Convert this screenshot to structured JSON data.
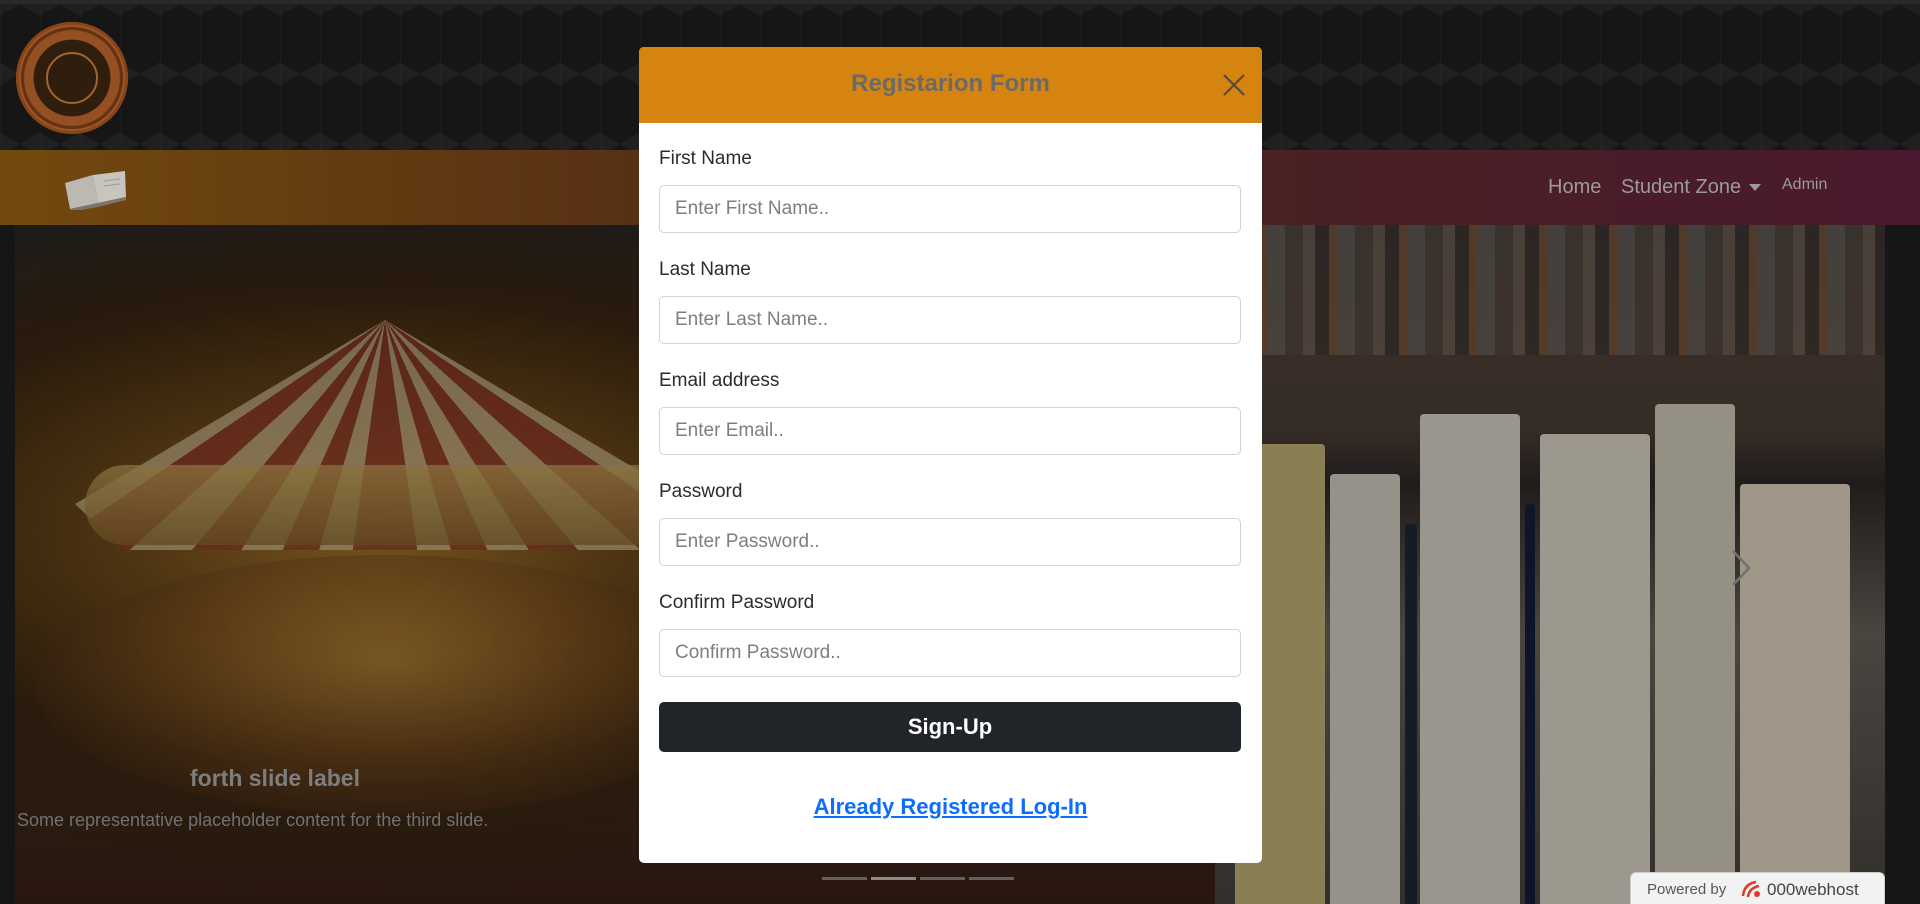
{
  "header": {
    "logo_alt": "A.S. Inter College seal logo"
  },
  "nav": {
    "items": [
      {
        "label": "Home"
      },
      {
        "label": "Student Zone"
      },
      {
        "label": "Admin"
      }
    ]
  },
  "carousel": {
    "caption_title": "forth slide label",
    "caption_text": "Some representative placeholder content for the third slide.",
    "indicator_count": 4,
    "active_indicator": 1
  },
  "modal": {
    "title": "Registarion Form",
    "fields": [
      {
        "label": "First Name",
        "placeholder": "Enter First Name.."
      },
      {
        "label": "Last Name",
        "placeholder": "Enter Last Name.."
      },
      {
        "label": "Email address",
        "placeholder": "Enter Email.."
      },
      {
        "label": "Password",
        "placeholder": "Enter Password.."
      },
      {
        "label": "Confirm Password",
        "placeholder": "Confirm Password.."
      }
    ],
    "submit_label": "Sign-Up",
    "login_link": "Already Registered Log-In"
  },
  "footer": {
    "powered_by": "Powered by",
    "host_name": "000webhost"
  },
  "colors": {
    "modal_header": "#d5840f",
    "button_dark": "#212529",
    "link_blue": "#0d6efd"
  }
}
